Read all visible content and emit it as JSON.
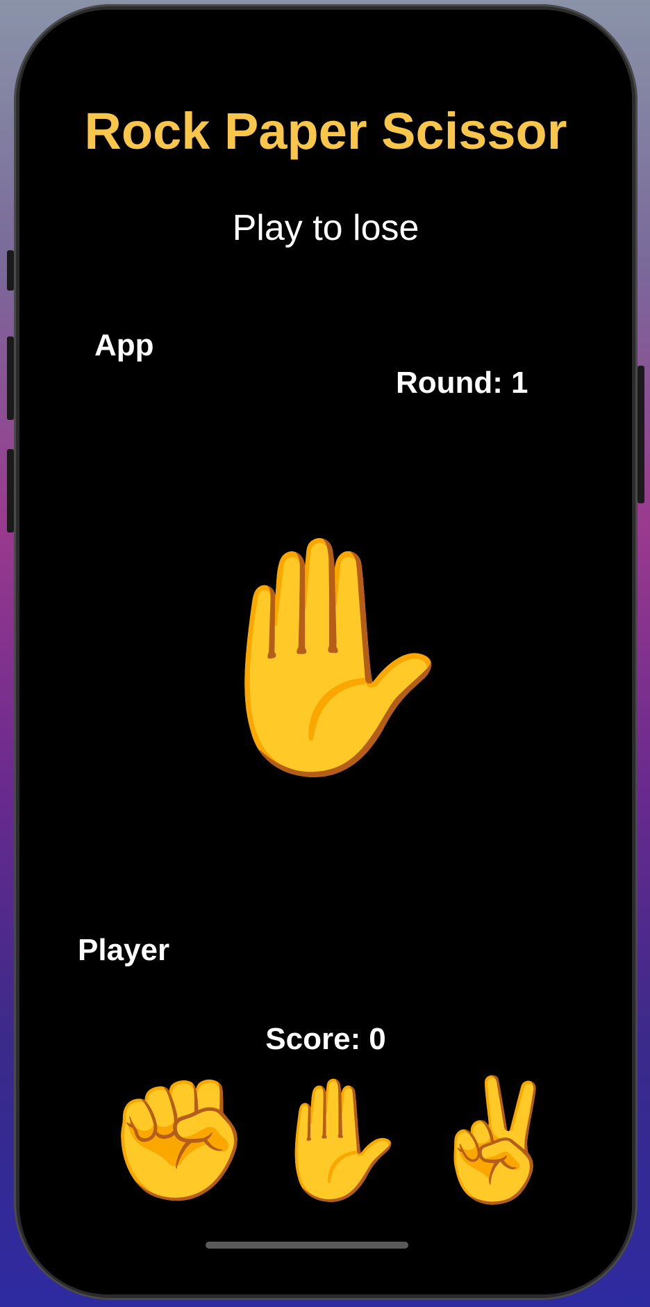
{
  "header": {
    "title": "Rock Paper Scissor",
    "subtitle": "Play to lose"
  },
  "app": {
    "label": "App",
    "choice_emoji": "✋"
  },
  "round": {
    "label": "Round:",
    "value": "1"
  },
  "player": {
    "label": "Player"
  },
  "score": {
    "label": "Score:",
    "value": "0"
  },
  "choices": [
    {
      "name": "rock",
      "emoji": "✊"
    },
    {
      "name": "paper",
      "emoji": "✋"
    },
    {
      "name": "scissors",
      "emoji": "✌️"
    }
  ],
  "colors": {
    "title": "#f7c64b",
    "screen_background": "#000000",
    "text": "#ffffff"
  }
}
